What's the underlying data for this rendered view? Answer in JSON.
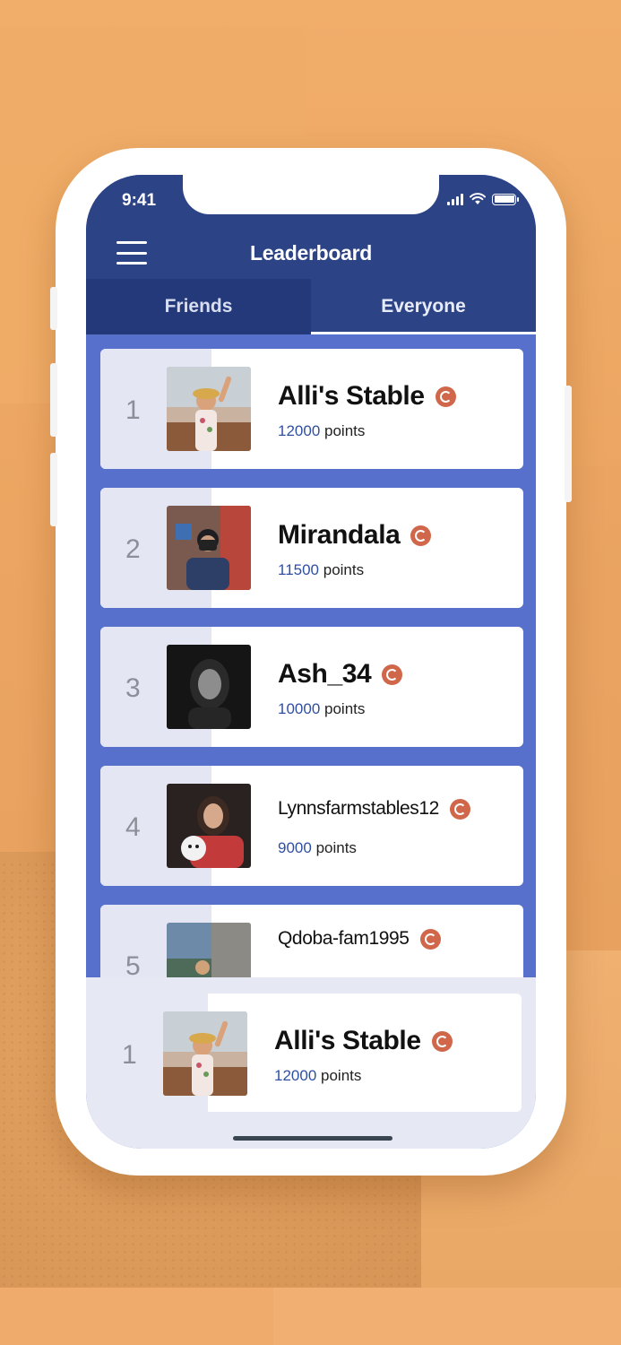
{
  "status_bar": {
    "time": "9:41"
  },
  "header": {
    "title": "Leaderboard",
    "menu_icon": "hamburger-menu-icon"
  },
  "tabs": [
    {
      "label": "Friends",
      "active": false
    },
    {
      "label": "Everyone",
      "active": true
    }
  ],
  "entries": [
    {
      "rank": "1",
      "name": "Alli's Stable",
      "points": "12000",
      "points_label": "points",
      "badge_icon": "horseshoe-badge-icon"
    },
    {
      "rank": "2",
      "name": "Mirandala",
      "points": "11500",
      "points_label": "points",
      "badge_icon": "horseshoe-badge-icon"
    },
    {
      "rank": "3",
      "name": "Ash_34",
      "points": "10000",
      "points_label": "points",
      "badge_icon": "horseshoe-badge-icon"
    },
    {
      "rank": "4",
      "name": "Lynnsfarmstables12",
      "points": "9000",
      "points_label": "points",
      "badge_icon": "horseshoe-badge-icon"
    },
    {
      "rank": "5",
      "name": "Qdoba-fam1995",
      "points": "",
      "points_label": "",
      "badge_icon": "horseshoe-badge-icon"
    }
  ],
  "current_user": {
    "rank": "1",
    "name": "Alli's Stable",
    "points": "12000",
    "points_label": "points",
    "badge_icon": "horseshoe-badge-icon"
  },
  "colors": {
    "header": "#2c4386",
    "list_bg": "#5670cb",
    "badge": "#d0674a",
    "points": "#2f4fa3",
    "background": "#eea865"
  }
}
